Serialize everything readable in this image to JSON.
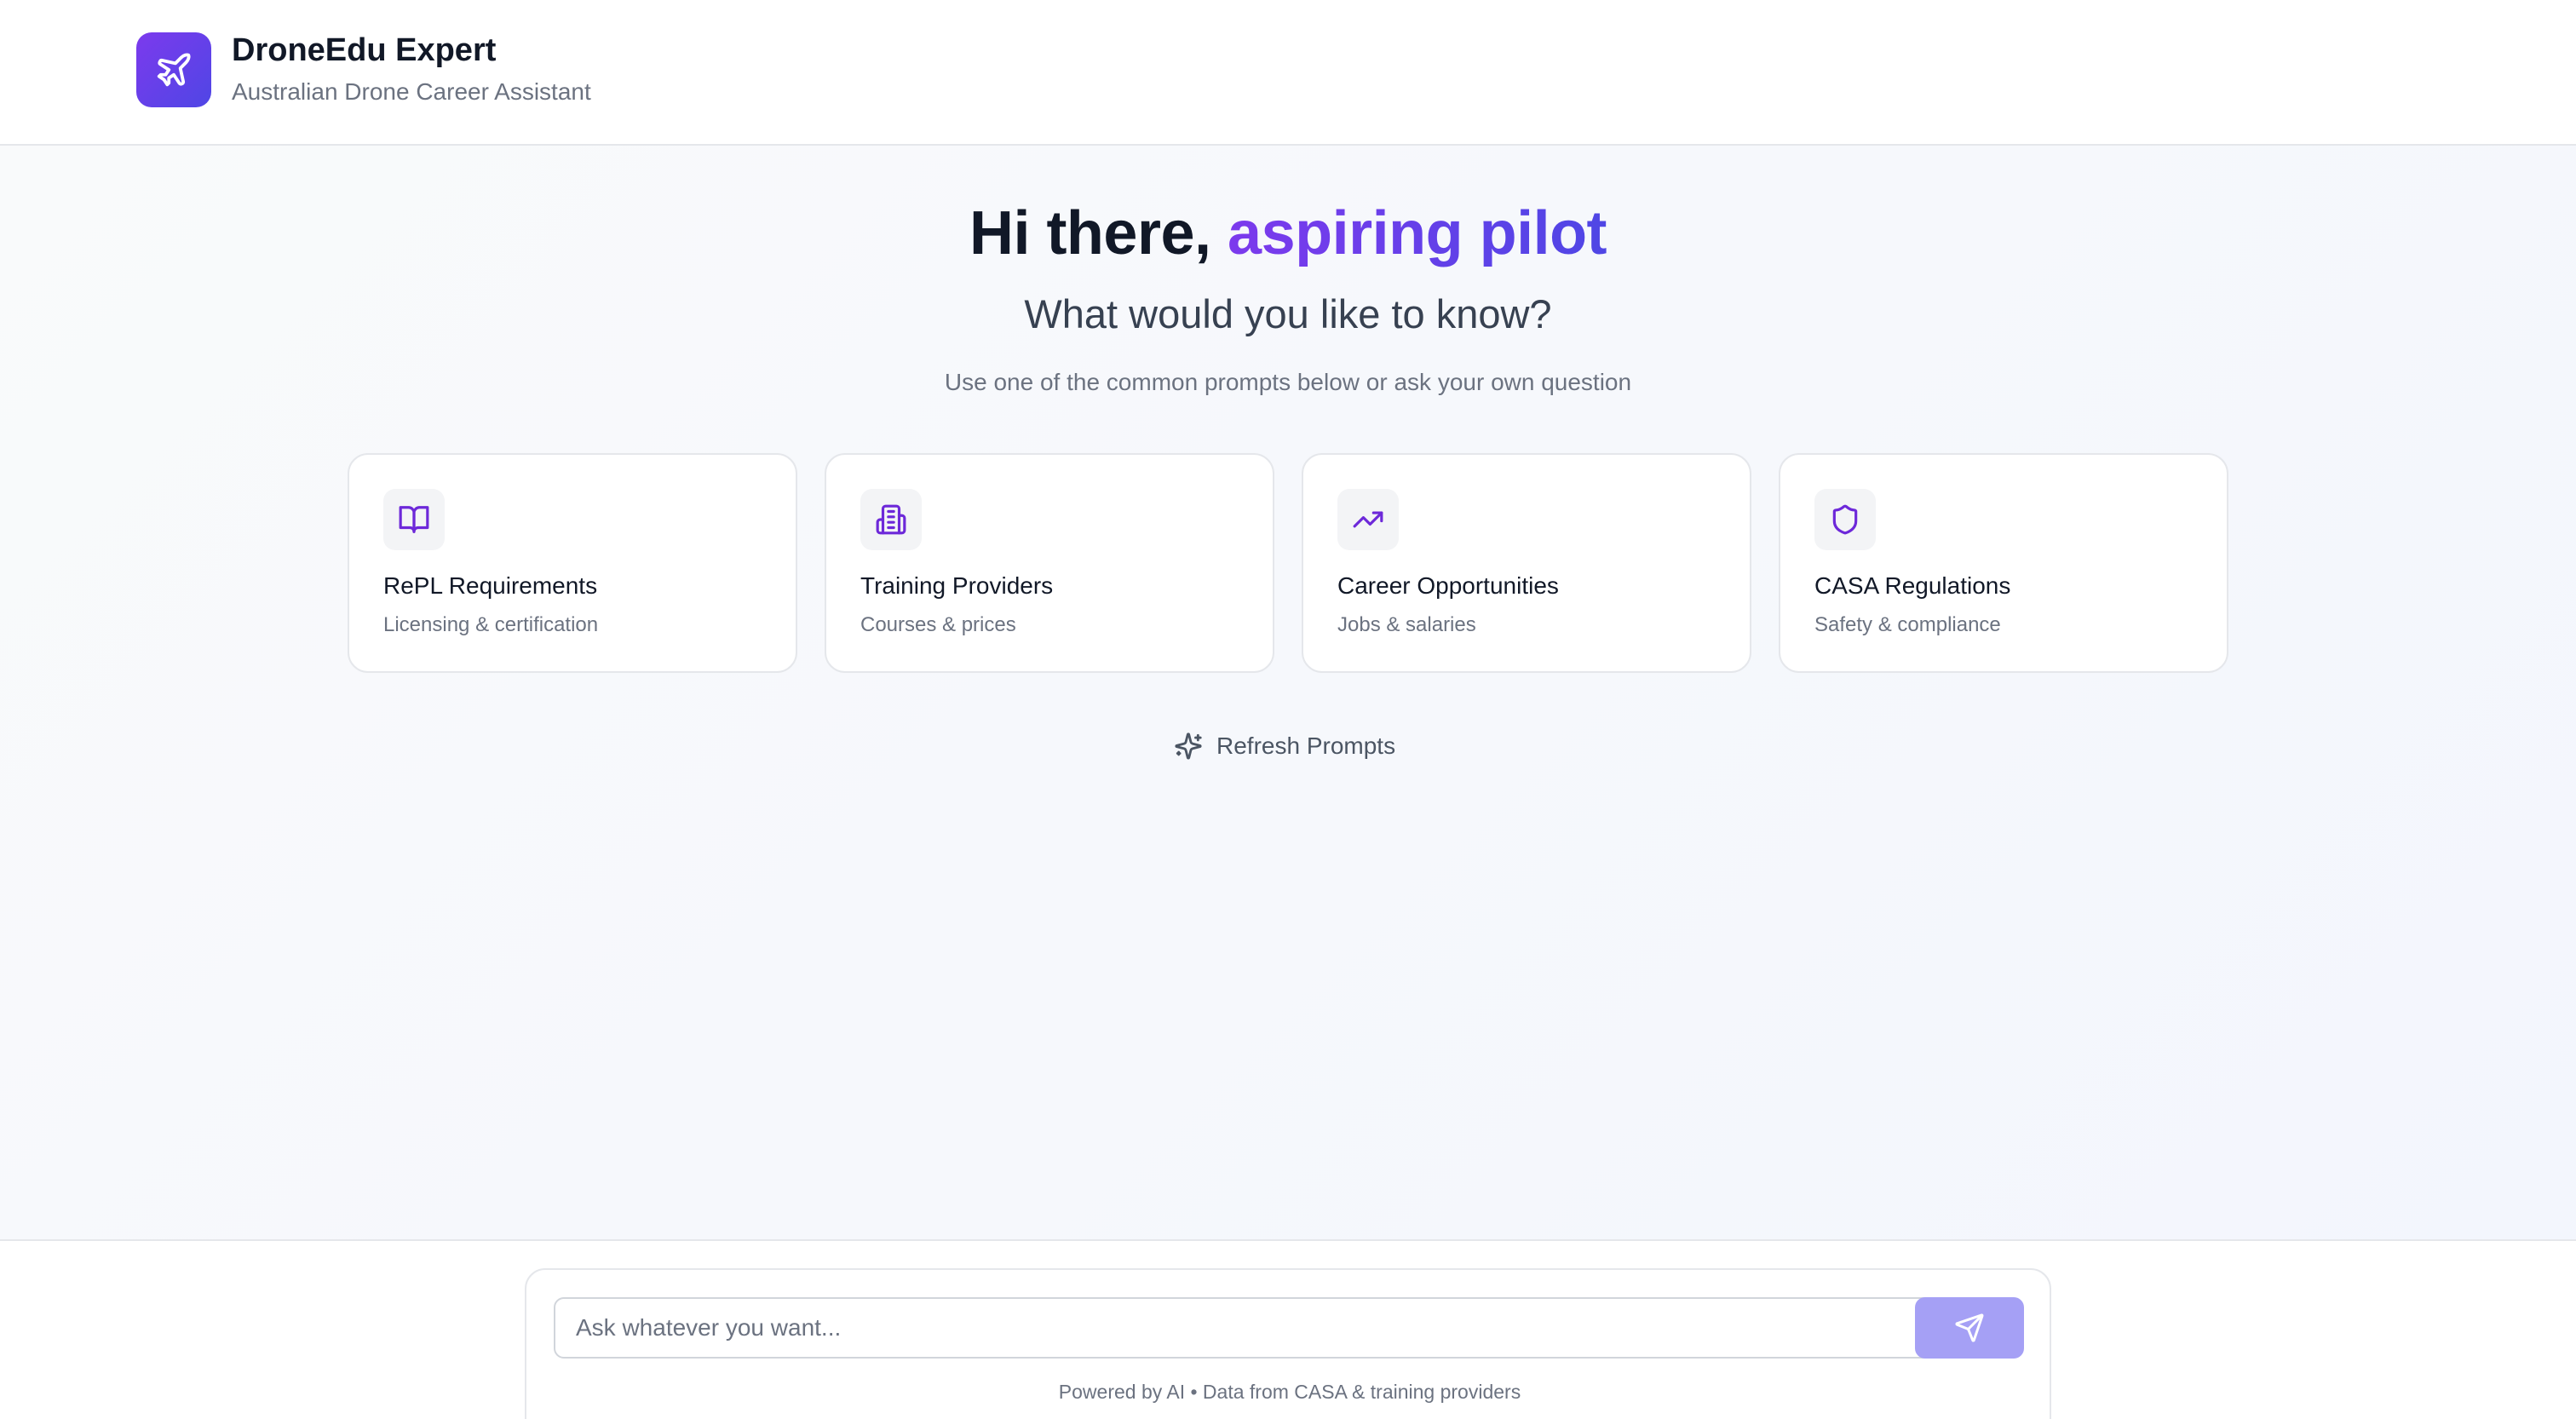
{
  "header": {
    "title": "DroneEdu Expert",
    "subtitle": "Australian Drone Career Assistant",
    "logo_icon": "plane-icon"
  },
  "hero": {
    "greeting_prefix": "Hi there, ",
    "greeting_accent": "aspiring pilot",
    "question": "What would you like to know?",
    "hint": "Use one of the common prompts below or ask your own question"
  },
  "prompts": [
    {
      "icon": "book-open-icon",
      "title": "RePL Requirements",
      "desc": "Licensing & certification"
    },
    {
      "icon": "building-icon",
      "title": "Training Providers",
      "desc": "Courses & prices"
    },
    {
      "icon": "trending-up-icon",
      "title": "Career Opportunities",
      "desc": "Jobs & salaries"
    },
    {
      "icon": "shield-icon",
      "title": "CASA Regulations",
      "desc": "Safety & compliance"
    }
  ],
  "refresh": {
    "label": "Refresh Prompts",
    "icon": "sparkles-icon"
  },
  "composer": {
    "placeholder": "Ask whatever you want...",
    "send_icon": "send-icon",
    "footer_note": "Powered by AI • Data from CASA & training providers"
  },
  "colors": {
    "accent_start": "#7c3aed",
    "accent_end": "#4f46e5",
    "send_button": "#a5a0f5"
  }
}
